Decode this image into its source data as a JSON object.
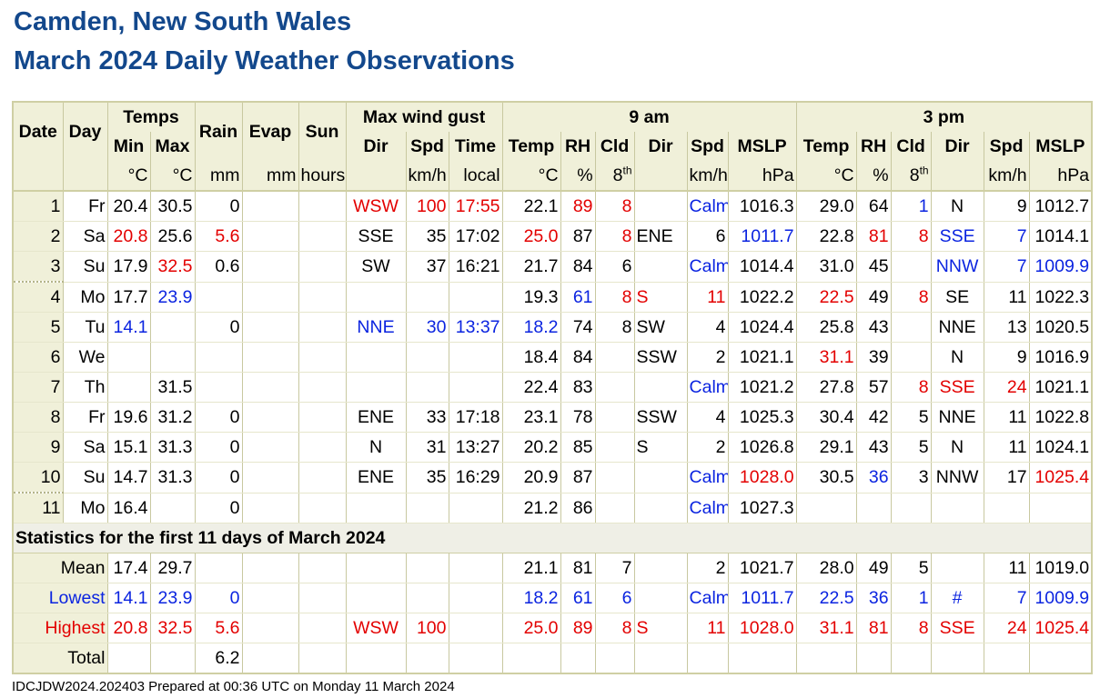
{
  "title_line1": "Camden, New South Wales",
  "title_line2": "March 2024 Daily Weather Observations",
  "headers": {
    "date": "Date",
    "day": "Day",
    "temps": "Temps",
    "min": "Min",
    "max": "Max",
    "rain": "Rain",
    "evap": "Evap",
    "sun": "Sun",
    "gust": "Max wind gust",
    "dir": "Dir",
    "spd": "Spd",
    "time": "Time",
    "am": "9 am",
    "pm": "3 pm",
    "temp": "Temp",
    "rh": "RH",
    "cld": "Cld",
    "mslp": "MSLP"
  },
  "units": {
    "c": "°C",
    "mm": "mm",
    "hours": "hours",
    "kmh": "km/h",
    "local": "local",
    "pct": "%",
    "eighths": "8",
    "eighths_sup": "th",
    "hpa": "hPa"
  },
  "rows": [
    [
      "1",
      "Fr",
      "20.4",
      "30.5",
      "0",
      "",
      "",
      "WSW",
      "100",
      "17:55",
      "22.1",
      "89",
      "8",
      "",
      "Calm",
      "1016.3",
      "29.0",
      "64",
      "1",
      "N",
      "9",
      "1012.7"
    ],
    [
      "2",
      "Sa",
      "20.8",
      "25.6",
      "5.6",
      "",
      "",
      "SSE",
      "35",
      "17:02",
      "25.0",
      "87",
      "8",
      "ENE",
      "6",
      "1011.7",
      "22.8",
      "81",
      "8",
      "SSE",
      "7",
      "1014.1"
    ],
    [
      "3",
      "Su",
      "17.9",
      "32.5",
      "0.6",
      "",
      "",
      "SW",
      "37",
      "16:21",
      "21.7",
      "84",
      "6",
      "",
      "Calm",
      "1014.4",
      "31.0",
      "45",
      "",
      "NNW",
      "7",
      "1009.9"
    ],
    [
      "4",
      "Mo",
      "17.7",
      "23.9",
      "",
      "",
      "",
      "",
      "",
      "",
      "19.3",
      "61",
      "8",
      "S",
      "11",
      "1022.2",
      "22.5",
      "49",
      "8",
      "SE",
      "11",
      "1022.3"
    ],
    [
      "5",
      "Tu",
      "14.1",
      "",
      "0",
      "",
      "",
      "NNE",
      "30",
      "13:37",
      "18.2",
      "74",
      "8",
      "SW",
      "4",
      "1024.4",
      "25.8",
      "43",
      "",
      "NNE",
      "13",
      "1020.5"
    ],
    [
      "6",
      "We",
      "",
      "",
      "",
      "",
      "",
      "",
      "",
      "",
      "18.4",
      "84",
      "",
      "SSW",
      "2",
      "1021.1",
      "31.1",
      "39",
      "",
      "N",
      "9",
      "1016.9"
    ],
    [
      "7",
      "Th",
      "",
      "31.5",
      "",
      "",
      "",
      "",
      "",
      "",
      "22.4",
      "83",
      "",
      "",
      "Calm",
      "1021.2",
      "27.8",
      "57",
      "8",
      "SSE",
      "24",
      "1021.1"
    ],
    [
      "8",
      "Fr",
      "19.6",
      "31.2",
      "0",
      "",
      "",
      "ENE",
      "33",
      "17:18",
      "23.1",
      "78",
      "",
      "SSW",
      "4",
      "1025.3",
      "30.4",
      "42",
      "5",
      "NNE",
      "11",
      "1022.8"
    ],
    [
      "9",
      "Sa",
      "15.1",
      "31.3",
      "0",
      "",
      "",
      "N",
      "31",
      "13:27",
      "20.2",
      "85",
      "",
      "S",
      "2",
      "1026.8",
      "29.1",
      "43",
      "5",
      "N",
      "11",
      "1024.1"
    ],
    [
      "10",
      "Su",
      "14.7",
      "31.3",
      "0",
      "",
      "",
      "ENE",
      "35",
      "16:29",
      "20.9",
      "87",
      "",
      "",
      "Calm",
      "1028.0",
      "30.5",
      "36",
      "3",
      "NNW",
      "17",
      "1025.4"
    ],
    [
      "11",
      "Mo",
      "16.4",
      "",
      "0",
      "",
      "",
      "",
      "",
      "",
      "21.2",
      "86",
      "",
      "",
      "Calm",
      "1027.3",
      "",
      "",
      "",
      "",
      "",
      ""
    ]
  ],
  "stats_title": "Statistics for the first 11 days of March 2024",
  "stats": [
    [
      "Mean",
      "17.4",
      "29.7",
      "",
      "",
      "",
      "",
      "",
      "",
      "21.1",
      "81",
      "7",
      "",
      "2",
      "1021.7",
      "28.0",
      "49",
      "5",
      "",
      "11",
      "1019.0"
    ],
    [
      "Lowest",
      "14.1",
      "23.9",
      "0",
      "",
      "",
      "",
      "",
      "",
      "18.2",
      "61",
      "6",
      "",
      "Calm",
      "1011.7",
      "22.5",
      "36",
      "1",
      "#",
      "7",
      "1009.9"
    ],
    [
      "Highest",
      "20.8",
      "32.5",
      "5.6",
      "",
      "",
      "WSW",
      "100",
      "",
      "25.0",
      "89",
      "8",
      "S",
      "11",
      "1028.0",
      "31.1",
      "81",
      "8",
      "SSE",
      "24",
      "1025.4"
    ],
    [
      "Total",
      "",
      "",
      "6.2",
      "",
      "",
      "",
      "",
      "",
      "",
      "",
      "",
      "",
      "",
      "",
      "",
      "",
      "",
      "",
      "",
      ""
    ]
  ],
  "colors": {
    "title": "#13488c",
    "red": "#e30000",
    "blue": "#0b24e0",
    "header_bg": "#f0f0d9"
  },
  "footer": "IDCJDW2024.202403   Prepared at 00:36 UTC on Monday 11 March 2024"
}
